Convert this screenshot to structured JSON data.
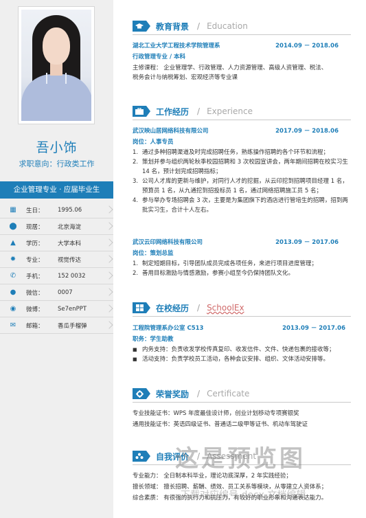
{
  "profile": {
    "name": "吾小饰",
    "intent": "求职意向：行政类工作",
    "banner": "企业管理专业 · 应届毕业生"
  },
  "info": [
    {
      "icon": "calendar-icon",
      "glyph": "▦",
      "label": "生日：",
      "value": "1995.06"
    },
    {
      "icon": "location-icon",
      "glyph": "⬤",
      "label": "现居：",
      "value": "北京海淀"
    },
    {
      "icon": "graduation-icon",
      "glyph": "▲",
      "label": "学历：",
      "value": "大学本科"
    },
    {
      "icon": "gear-icon",
      "glyph": "✹",
      "label": "专业：",
      "value": "视觉传达"
    },
    {
      "icon": "phone-icon",
      "glyph": "✆",
      "label": "手机：",
      "value": "152        0032"
    },
    {
      "icon": "chat-icon",
      "glyph": "●",
      "label": "微信：",
      "value": "0007"
    },
    {
      "icon": "weibo-icon",
      "glyph": "◉",
      "label": "微博：",
      "value": "Se7enPPT"
    },
    {
      "icon": "mail-icon",
      "glyph": "✉",
      "label": "邮箱：",
      "value": "香瓜手榴弹"
    }
  ],
  "sections": {
    "education": {
      "title": "教育背景",
      "slash": "/",
      "en": "Education"
    },
    "work": {
      "title": "工作经历",
      "slash": "/",
      "en": "Experience"
    },
    "school": {
      "title": "在校经历",
      "slash": "/",
      "en": "SchoolEx"
    },
    "honor": {
      "title": "荣誉奖励",
      "slash": "/",
      "en": "Certificate"
    },
    "self": {
      "title": "自我评价",
      "slash": "/",
      "en": "Assessment"
    }
  },
  "education": {
    "school": "湖北工业大学工程技术学院管理系",
    "period": "2014.09 － 2018.06",
    "major": "行政管理专业 / 本科",
    "courses_1": "主修课程：  企业管理学、行政管理、人力资源管理、高级人资管理、税法、",
    "courses_2": "税务会计与纳税筹划、宏观经济等专业课"
  },
  "work": [
    {
      "company": "武汉映山居网络科技有限公司",
      "period": "2017.09 － 2018.06",
      "role": "岗位：人事专员",
      "items": [
        {
          "n": "1.",
          "t": "通过多种招聘渠道及时完成招聘任务，熟练操作招聘的各个环节和流程；"
        },
        {
          "n": "2.",
          "t": "策划并参与组织两轮秋季校园招聘和 3 次校园宣讲会，两年期间招聘在校实习生 14 名，预计划完成招聘指标；"
        },
        {
          "n": "3.",
          "t": "公司人才库的更新与维护，对同行人才的挖掘，从云印挖到招聘项目经理 1 名，预算员 1 名，从九通挖到招投标员 1 名，通过网络招聘施工员 5 名；"
        },
        {
          "n": "4.",
          "t": "参与举办专场招聘会 3 次，主要是为集团旗下的酒店进行管培生的招聘，招到两批实习生，合计十人左右。"
        }
      ]
    },
    {
      "company": "武汉云印网络科技有限公司",
      "period": "2013.09 － 2017.06",
      "role": "岗位：策划总监",
      "items": [
        {
          "n": "1.",
          "t": "制定短期目标，引导团队成员完成各项任务，来进行项目进度管理；"
        },
        {
          "n": "2.",
          "t": "善用目标激励与情感激励，参赛小组至今仍保持团队文化。"
        }
      ]
    }
  ],
  "school": {
    "org": "工程院管理系办公室 C513",
    "period": "2013.09 － 2017.06",
    "role": "职务：学生助教",
    "items": [
      {
        "n": "■",
        "t": "内务支持：负责收发学校传真复印、收发信件、文件、快递包裹的接收等；"
      },
      {
        "n": "■",
        "t": "活动支持：负责学校员工活动，各种会议安排、组织、文体活动安排等。"
      }
    ]
  },
  "honor": {
    "line_1": "专业技能证书：WPS 年度最佳设计师，创业计划移动专项赛银奖",
    "line_2": "通用技能证书：英语四级证书、普通话二级甲等证书、机动车驾驶证"
  },
  "self": {
    "line_1": "专业能力：   全日制本科毕业，理论功底深厚，2 年实践经验；",
    "line_2": "擅长领域：   擅长招聘、薪酬、绩效、员工关系等模块，从零建立人资体系；",
    "line_3": "综合素质：   有很强的执行力和抗压力，有较好的职业形象和沟通表达能力。"
  },
  "watermark": {
    "main": "这是预览图",
    "sub": "下载对应编号 docx 文档编辑"
  },
  "colors": {
    "accent": "#1e7eb8",
    "sidebar": "#efefef"
  }
}
